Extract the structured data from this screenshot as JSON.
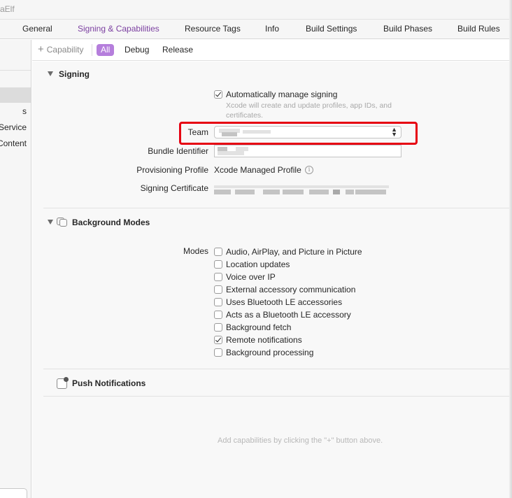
{
  "window": {
    "title_fragment": "aElf"
  },
  "tabs": [
    {
      "label": "General"
    },
    {
      "label": "Signing & Capabilities",
      "active": true
    },
    {
      "label": "Resource Tags"
    },
    {
      "label": "Info"
    },
    {
      "label": "Build Settings"
    },
    {
      "label": "Build Phases"
    },
    {
      "label": "Build Rules"
    }
  ],
  "sidebar": {
    "items": [
      "s",
      "Service",
      "Content"
    ]
  },
  "toolbar": {
    "capability_label": "Capability",
    "filters": [
      {
        "label": "All",
        "active": true
      },
      {
        "label": "Debug"
      },
      {
        "label": "Release"
      }
    ]
  },
  "signing": {
    "title": "Signing",
    "auto_manage_label": "Automatically manage signing",
    "auto_manage_checked": true,
    "auto_manage_hint": "Xcode will create and update profiles, app IDs, and certificates.",
    "team_label": "Team",
    "bundle_id_label": "Bundle Identifier",
    "provisioning_label": "Provisioning Profile",
    "provisioning_value": "Xcode Managed Profile",
    "certificate_label": "Signing Certificate"
  },
  "background_modes": {
    "title": "Background Modes",
    "modes_label": "Modes",
    "modes": [
      {
        "label": "Audio, AirPlay, and Picture in Picture",
        "checked": false
      },
      {
        "label": "Location updates",
        "checked": false
      },
      {
        "label": "Voice over IP",
        "checked": false
      },
      {
        "label": "External accessory communication",
        "checked": false
      },
      {
        "label": "Uses Bluetooth LE accessories",
        "checked": false
      },
      {
        "label": "Acts as a Bluetooth LE accessory",
        "checked": false
      },
      {
        "label": "Background fetch",
        "checked": false
      },
      {
        "label": "Remote notifications",
        "checked": true
      },
      {
        "label": "Background processing",
        "checked": false
      }
    ]
  },
  "push": {
    "title": "Push Notifications"
  },
  "empty_hint": "Add capabilities by clicking the \"+\" button above.",
  "colors": {
    "accent": "#7b3fa0",
    "filter_active": "#b57edc",
    "highlight": "#e60012"
  },
  "icons": [
    "plus-icon",
    "disclosure-triangle-icon",
    "info-icon",
    "up-down-chevron-icon",
    "background-modes-icon",
    "push-notifications-icon",
    "checkmark-icon"
  ]
}
